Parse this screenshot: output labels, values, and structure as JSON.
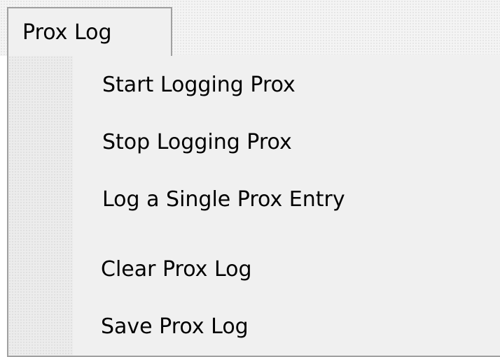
{
  "menu": {
    "title": "Prox Log",
    "items": [
      {
        "label": "Start Logging Prox"
      },
      {
        "label": "Stop Logging Prox"
      },
      {
        "label": "Log a Single Prox Entry"
      },
      {
        "label": "Clear Prox Log"
      },
      {
        "label": "Save Prox Log"
      }
    ]
  },
  "colors": {
    "menu_background": "#f0f0f0",
    "border": "#a0a0a0",
    "text": "#000000"
  }
}
